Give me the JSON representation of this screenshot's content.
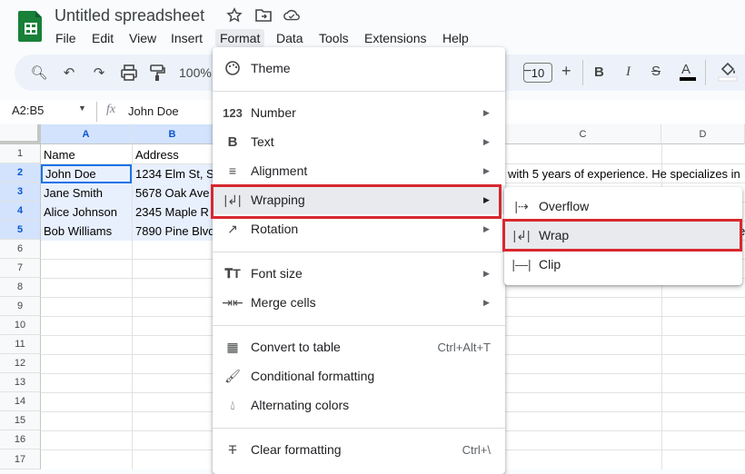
{
  "app": {
    "title": "Untitled spreadsheet",
    "menu": [
      "File",
      "Edit",
      "View",
      "Insert",
      "Format",
      "Data",
      "Tools",
      "Extensions",
      "Help"
    ]
  },
  "toolbar": {
    "zoom": "100%",
    "font_size": "10"
  },
  "formula_bar": {
    "name_box": "A2:B5",
    "fx": "fx",
    "value": "John Doe"
  },
  "grid": {
    "columns": [
      "A",
      "B",
      "C",
      "D"
    ],
    "rows": [
      "1",
      "2",
      "3",
      "4",
      "5",
      "6",
      "7",
      "8",
      "9",
      "10",
      "11",
      "12",
      "13",
      "14",
      "15",
      "16",
      "17"
    ],
    "col_a": [
      "Name",
      "John Doe",
      "Jane Smith",
      "Alice Johnson",
      "Bob Williams"
    ],
    "col_b": [
      "Address",
      "1234 Elm St, S",
      "5678 Oak Ave",
      "2345 Maple R",
      "7890 Pine Blvd"
    ],
    "overflow_text": "with 5 years of experience. He specializes in",
    "row5_overflow": "e"
  },
  "format_menu": {
    "items": [
      {
        "icon": "palette-icon",
        "label": "Theme"
      },
      {
        "icon": "number-icon",
        "label": "Number"
      },
      {
        "icon": "bold-icon",
        "label": "Text"
      },
      {
        "icon": "align-icon",
        "label": "Alignment"
      },
      {
        "icon": "wrap-icon",
        "label": "Wrapping"
      },
      {
        "icon": "rotation-icon",
        "label": "Rotation"
      },
      {
        "icon": "font-size-icon",
        "label": "Font size"
      },
      {
        "icon": "merge-icon",
        "label": "Merge cells"
      },
      {
        "icon": "table-icon",
        "label": "Convert to table",
        "shortcut": "Ctrl+Alt+T"
      },
      {
        "icon": "conditional-format-icon",
        "label": "Conditional formatting"
      },
      {
        "icon": "alternating-colors-icon",
        "label": "Alternating colors"
      },
      {
        "icon": "clear-format-icon",
        "label": "Clear formatting",
        "shortcut": "Ctrl+\\"
      }
    ]
  },
  "wrapping_submenu": {
    "items": [
      {
        "icon": "overflow-icon",
        "label": "Overflow"
      },
      {
        "icon": "wrap-icon",
        "label": "Wrap"
      },
      {
        "icon": "clip-icon",
        "label": "Clip"
      }
    ]
  },
  "colors": {
    "highlight": "#d7282f",
    "selection": "#0b57d0",
    "sheets_green": "#188038"
  }
}
